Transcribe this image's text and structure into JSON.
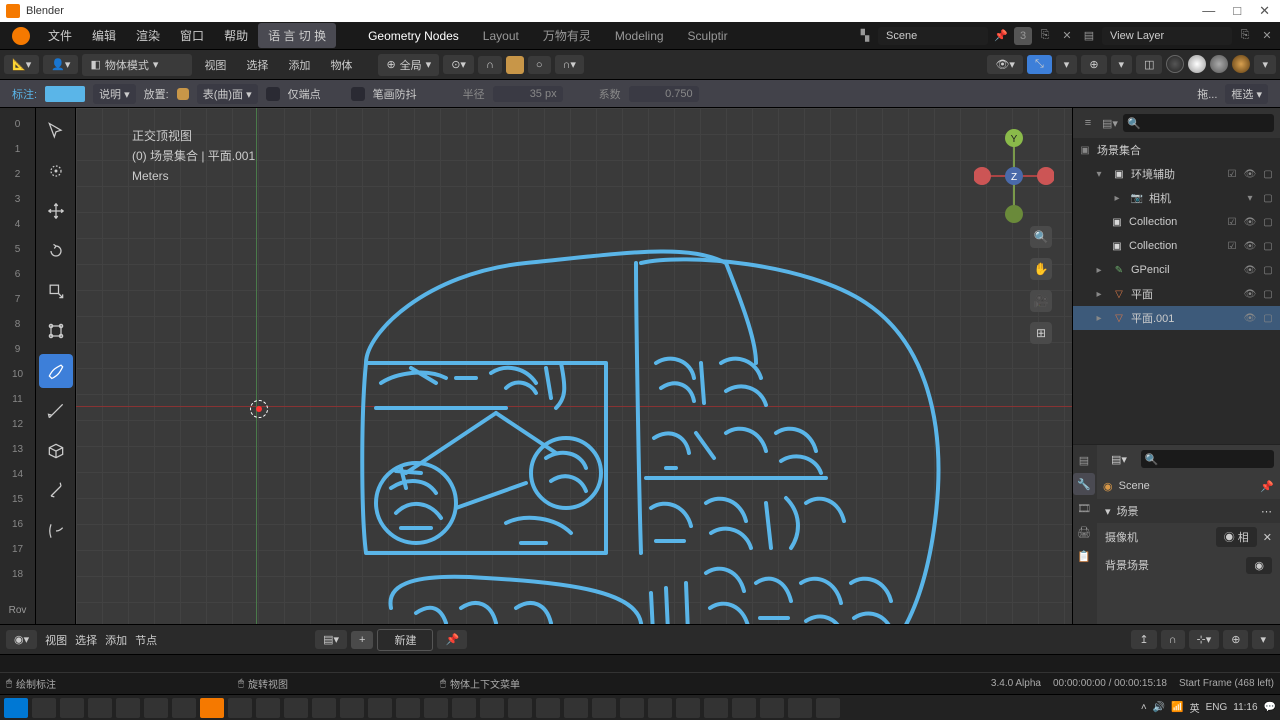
{
  "app": {
    "title": "Blender"
  },
  "titlebar_buttons": [
    "—",
    "□",
    "✕"
  ],
  "topmenu": [
    "文件",
    "编辑",
    "渲染",
    "窗口",
    "帮助"
  ],
  "lang_switch": "语 言 切 换",
  "workspaces": [
    "Geometry Nodes",
    "Layout",
    "万物有灵",
    "Modeling",
    "Sculptir"
  ],
  "scene_name": "Scene",
  "scene_badge": "3",
  "viewlayer_name": "View Layer",
  "mode": "物体模式",
  "header_menus": [
    "视图",
    "选择",
    "添加",
    "物体"
  ],
  "orientation": "全局",
  "annot": {
    "label": "标注:",
    "desc": "说明",
    "place": "放置:",
    "place_val": "表(曲)面",
    "only_endpoints": "仅端点",
    "stabilize": "笔画防抖",
    "radius_label": "半径",
    "radius": "35 px",
    "factor_label": "系数",
    "factor": "0.750",
    "drag": "拖...",
    "box": "框选"
  },
  "viewport_label_1": "正交顶视图",
  "viewport_label_2": "(0) 场景集合 | 平面.001",
  "viewport_label_3": "Meters",
  "outliner_root": "场景集合",
  "outliner": [
    {
      "name": "环境辅助",
      "indent": 1,
      "type": "collection"
    },
    {
      "name": "相机",
      "indent": 2,
      "type": "camera"
    },
    {
      "name": "Collection",
      "indent": 2,
      "type": "collection"
    },
    {
      "name": "Collection",
      "indent": 2,
      "type": "collection"
    },
    {
      "name": "GPencil",
      "indent": 1,
      "type": "gpencil"
    },
    {
      "name": "平面",
      "indent": 1,
      "type": "mesh"
    },
    {
      "name": "平面.001",
      "indent": 1,
      "type": "mesh",
      "active": true
    }
  ],
  "gutter_numbers": [
    "0",
    "1",
    "2",
    "3",
    "4",
    "5",
    "6",
    "7",
    "8",
    "9",
    "10",
    "11",
    "12",
    "13",
    "14",
    "15",
    "16",
    "17",
    "18"
  ],
  "gutter_rov": "Rov",
  "node_menus": [
    "视图",
    "选择",
    "添加",
    "节点"
  ],
  "node_new": "新建",
  "props": {
    "scene": "Scene",
    "panel": "场景",
    "camera_label": "摄像机",
    "camera_value": "相",
    "bg_label": "背景场景"
  },
  "status": {
    "draw": "绘制标注",
    "rotate": "旋转视图",
    "context": "物体上下文菜单",
    "version": "3.4.0 Alpha",
    "time": "00:00:00:00 / 00:00:15:18",
    "frame": "Start Frame (468 left)"
  },
  "sysclock": {
    "ime": "英",
    "lang": "ENG",
    "time": "11:16"
  }
}
